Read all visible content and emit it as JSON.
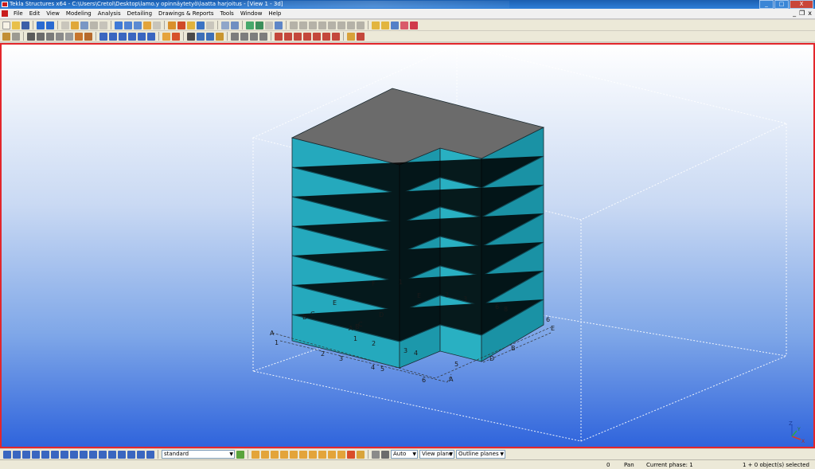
{
  "window": {
    "title": "Tekla Structures x64 - C:\\Users\\Cretol\\Desktop\\lamo.y opinnäytetyö\\laatta harjoitus - [View 1 - 3d]",
    "minimize": "_",
    "maximize": "□",
    "close": "X"
  },
  "menu": {
    "items": [
      "File",
      "Edit",
      "View",
      "Modeling",
      "Analysis",
      "Detailing",
      "Drawings & Reports",
      "Tools",
      "Window",
      "Help"
    ],
    "mdi_minimize": "_",
    "mdi_restore": "❐",
    "mdi_close": "x"
  },
  "viewport": {
    "name": "View 1 - 3d",
    "roof_color": "#6b6b6b",
    "wall_color": "#1fa0b4",
    "border_color": "#e3262b",
    "labels": {
      "A_left": "A",
      "one_left": "1",
      "two_front": "2",
      "three_front": "3",
      "four_front": "4",
      "five_front": "5",
      "six_front": "6",
      "A_front": "A",
      "five_right": "5",
      "D_right": "D",
      "B_right": "B",
      "six_right": "6",
      "E_right": "E",
      "F_face": "F",
      "one_face": "1",
      "E_face_left": "E",
      "E_face_mid": "E",
      "D_face": "D",
      "C_face": "C",
      "B_face": "B",
      "A_face": "A",
      "two_face": "2",
      "one_low": "1",
      "three_low": "3",
      "four_low": "4",
      "two_notch": "2",
      "three_notch": "3",
      "six_face": "6",
      "eight_face": "8",
      "B_left": "B"
    },
    "axis": {
      "z": "Z",
      "x": "X",
      "y": "Y"
    }
  },
  "bottom_toolbar": {
    "profile_select": "standard",
    "auto_select": "Auto",
    "plane_select": "View plane",
    "outline_select": "Outline planes"
  },
  "status": {
    "counter": "0",
    "mode": "Pan",
    "phase": "Current phase: 1",
    "selection": "1 + 0 object(s) selected"
  }
}
